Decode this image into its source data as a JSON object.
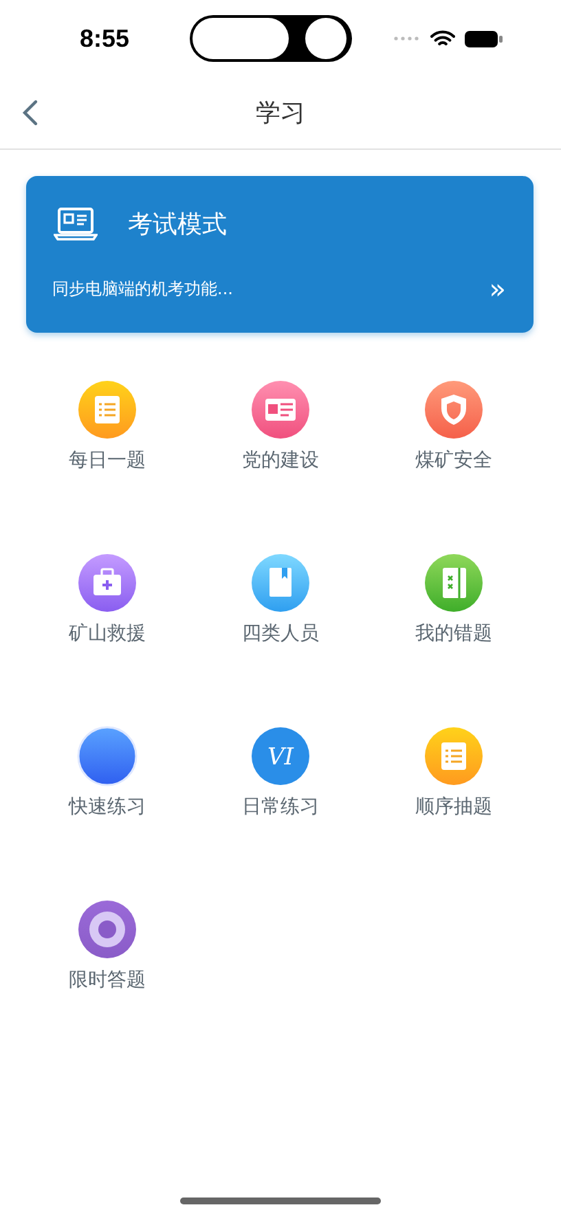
{
  "status_bar": {
    "time": "8:55"
  },
  "nav": {
    "title": "学习"
  },
  "exam_card": {
    "title": "考试模式",
    "subtitle": "同步电脑端的机考功能...",
    "more": "»"
  },
  "items": [
    {
      "label": "每日一题",
      "kind": "checklist"
    },
    {
      "label": "党的建设",
      "kind": "idcard"
    },
    {
      "label": "煤矿安全",
      "kind": "shield"
    },
    {
      "label": "矿山救援",
      "kind": "medkit"
    },
    {
      "label": "四类人员",
      "kind": "book"
    },
    {
      "label": "我的错题",
      "kind": "notebook"
    },
    {
      "label": "快速练习",
      "kind": "ball"
    },
    {
      "label": "日常练习",
      "kind": "script",
      "glyph": "VI"
    },
    {
      "label": "顺序抽题",
      "kind": "checklist"
    },
    {
      "label": "限时答题",
      "kind": "ring"
    }
  ]
}
